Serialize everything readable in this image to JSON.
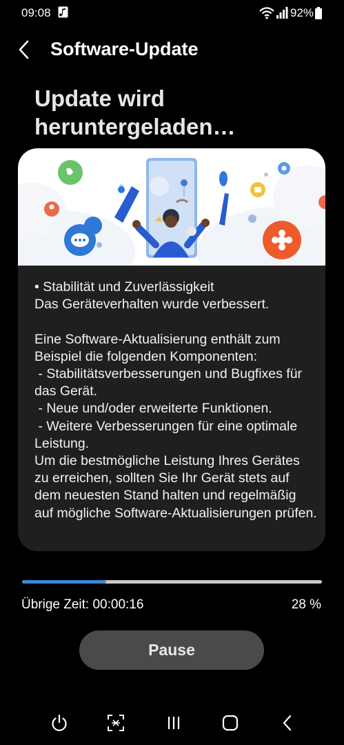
{
  "status_bar": {
    "time": "09:08",
    "battery_percent": "92%",
    "icons": [
      "media-icon",
      "wifi-icon",
      "signal-icon",
      "battery-icon"
    ]
  },
  "header": {
    "title": "Software-Update",
    "back_icon": "chevron-left-icon"
  },
  "main": {
    "headline": "Update wird heruntergeladen…",
    "release_notes": "• Stabilität und Zuverlässigkeit\nDas Geräteverhalten wurde verbessert.\n\nEine Software-Aktualisierung enthält zum Beispiel die folgenden Komponenten:\n - Stabilitätsverbesserungen und Bugfixes für das Gerät.\n - Neue und/oder erweiterte Funktionen.\n - Weitere Verbesserungen für eine optimale Leistung.\nUm die bestmögliche Leistung Ihres Gerätes zu erreichen, sollten Sie Ihr Gerät stets auf dem neuesten Stand halten und regelmäßig auf mögliche Software-Aktualisierungen prüfen."
  },
  "download": {
    "progress": 0.28,
    "remaining_label": "Übrige Zeit: 00:00:16",
    "percent_label": "28 %",
    "accent_color": "#3e87d6"
  },
  "actions": {
    "pause_label": "Pause"
  },
  "navigation_bar": {
    "icons": [
      "power-icon",
      "scan-icon",
      "recents-icon",
      "home-icon",
      "back-icon"
    ]
  }
}
